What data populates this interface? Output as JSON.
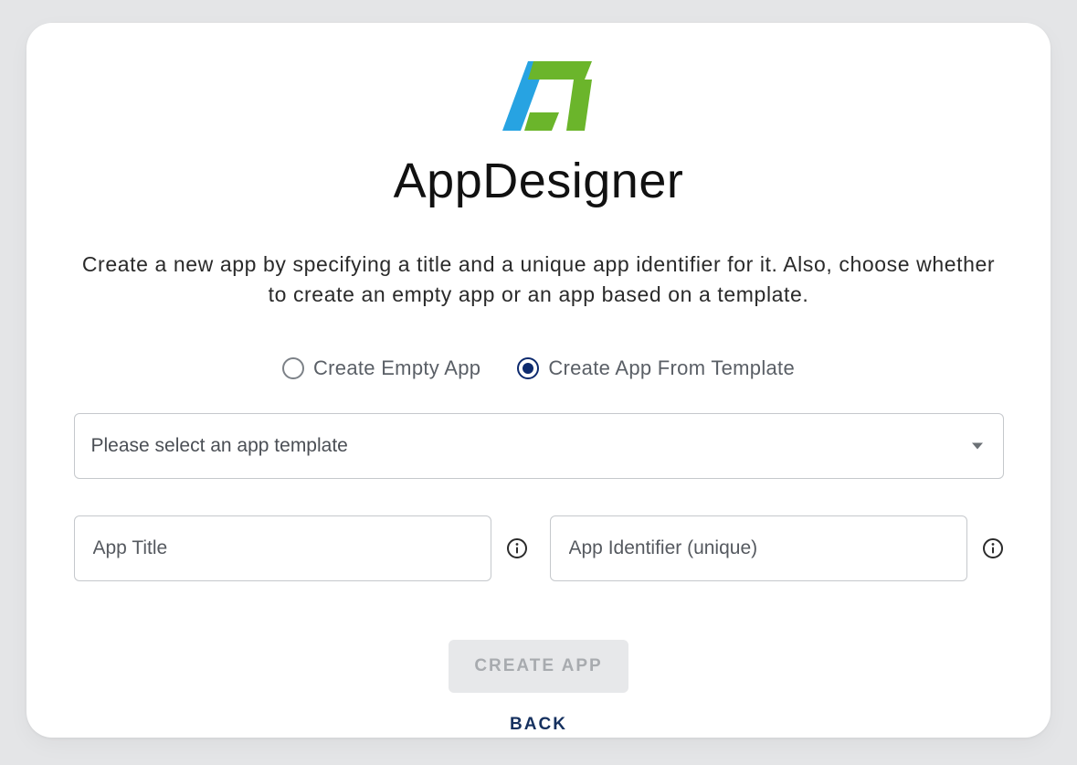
{
  "brand": {
    "name": "AppDesigner",
    "logo_colors": {
      "blue": "#27a3e2",
      "green": "#6bb52b"
    }
  },
  "intro_text": "Create a new app by specifying a title and a unique app identifier for it. Also, choose whether to create an empty app or an app based on a template.",
  "radios": {
    "create_empty_label": "Create Empty App",
    "create_from_template_label": "Create App From Template",
    "selected": "create_from_template"
  },
  "template_select": {
    "placeholder": "Please select an app template",
    "value": ""
  },
  "fields": {
    "app_title": {
      "placeholder": "App Title",
      "value": ""
    },
    "app_identifier": {
      "placeholder": "App Identifier (unique)",
      "value": ""
    }
  },
  "buttons": {
    "create_app_label": "CREATE APP",
    "back_label": "BACK"
  },
  "icons": {
    "info": "info-icon",
    "caret_down": "caret-down-icon"
  }
}
